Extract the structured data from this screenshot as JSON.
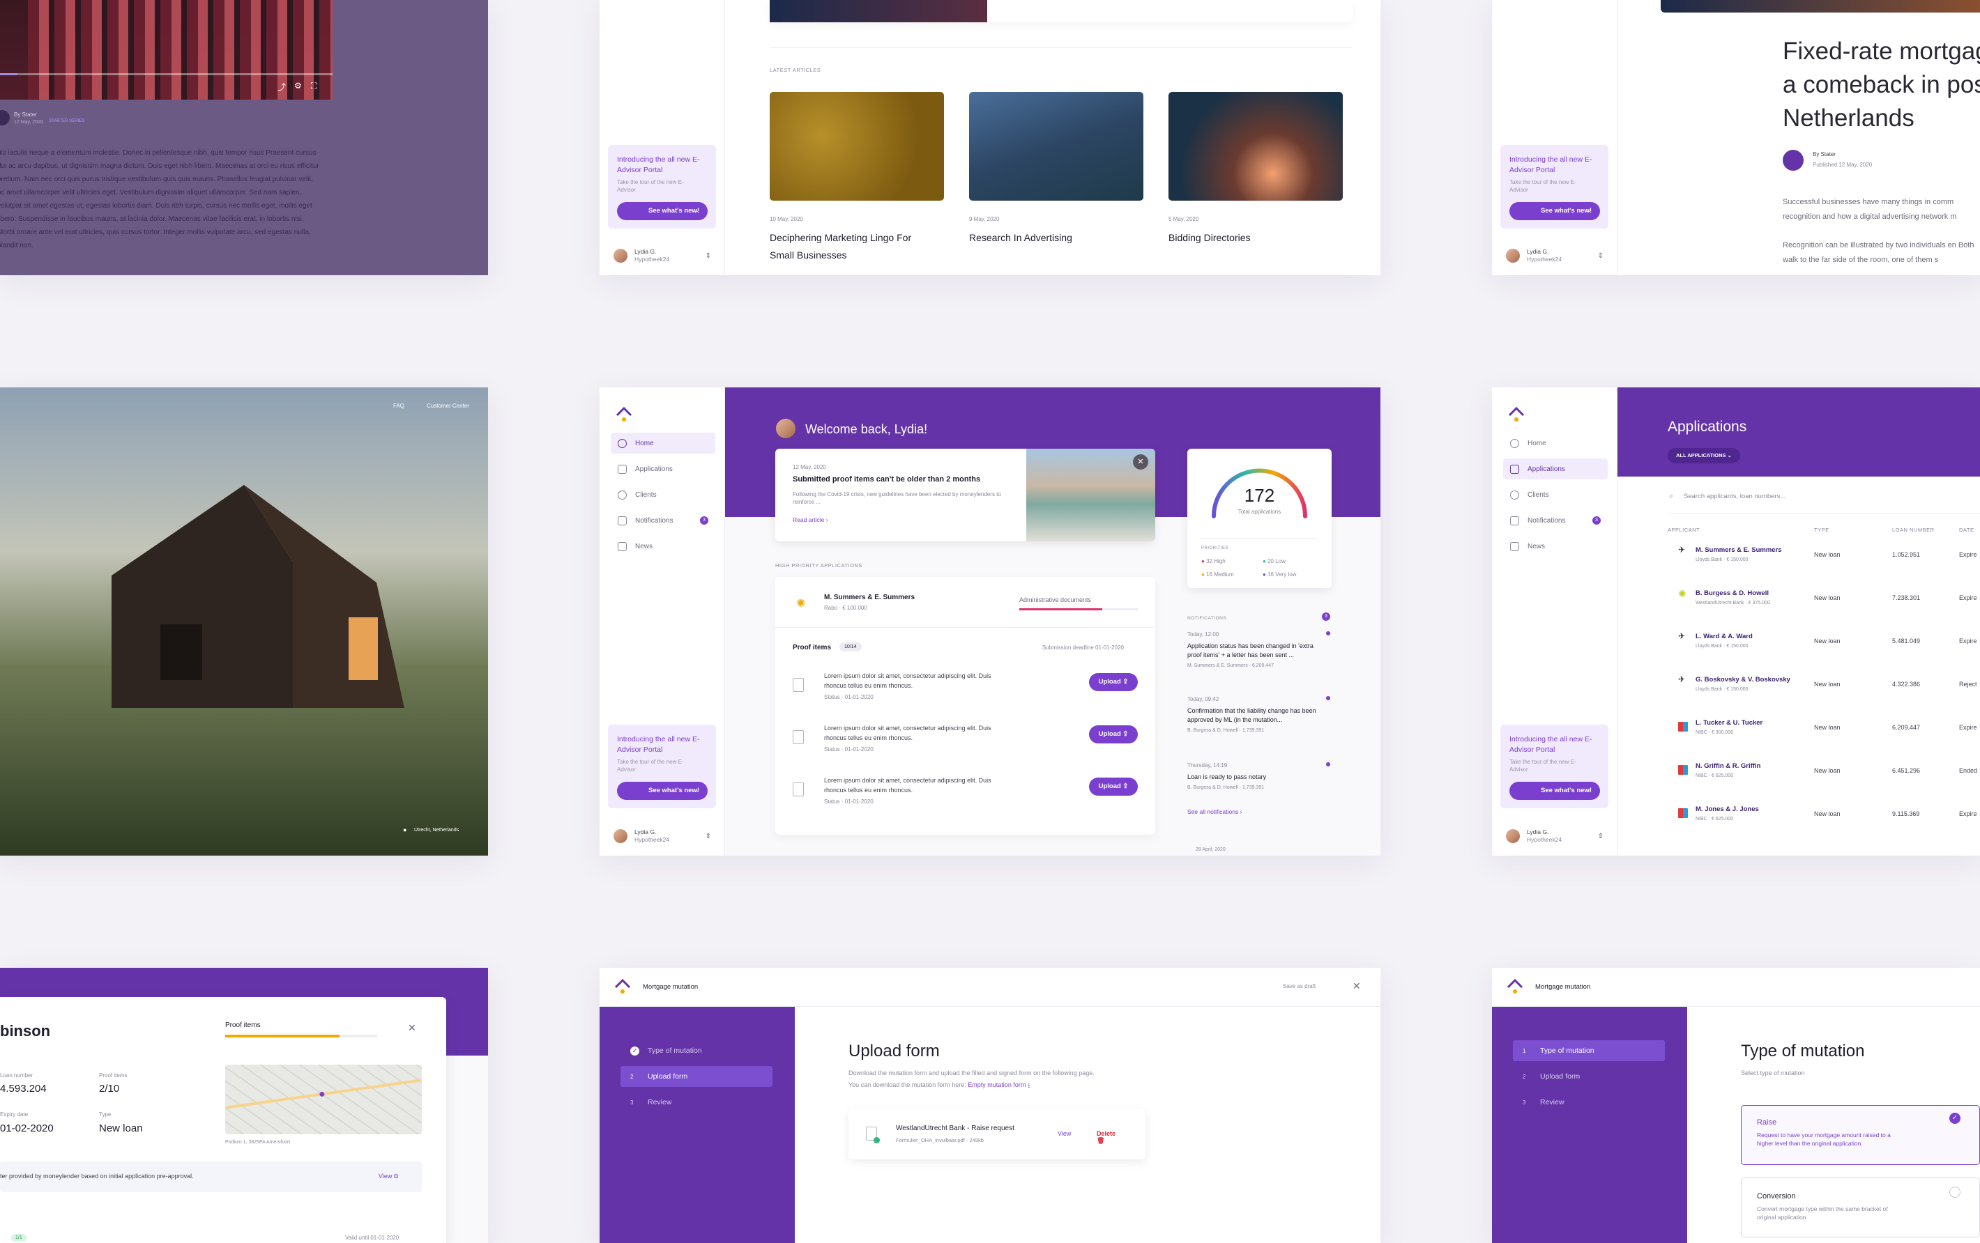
{
  "video_card": {
    "byline": "By Stater",
    "date": "12 May, 2020",
    "tag": "STARTER SERIES",
    "body": "uis iaculis neque a elementum molestie. Donec in pellentesque nibh, quis tempor risus Praesent cursus dui ac arcu dapibus, ut dignissim magna dictum. Duis eget nibh libero. Maecenas at orci eu risus efficitur pretium. Nam nec orci quis purus tristique vestibulum quis quis mauris. Phasellus feugiat pulvinar velit, ac amet ullamcorper velit ultricies eget. Vestibulum dignissim aliquet ullamcorper. Sed nam sapien, volutpat sit amet egestas ut, egestas lobortis diam. Duis ribh turpis, cursus nec mollis eget, mollis eget libero. Suspendisse in faucibus mauris, at lacinia dolor. Maecenas vitae facilisis erat, in lobortis nisi. Morbi ornare ante vel erat ultricies, quis cursus tortor. Integer mollis vulputate arcu, sed egestas nulla, blandit non."
  },
  "promo": {
    "title": "Introducing the all new E-Advisor Portal",
    "subtitle": "Take the tour of the new E-Advisor",
    "button": "See what's new!"
  },
  "user": {
    "name": "Lydia G.",
    "company": "Hypotheek24"
  },
  "articles": {
    "section": "LATEST ARTICLES",
    "items": [
      {
        "date": "10 May, 2020",
        "title": "Deciphering Marketing Lingo For Small Businesses"
      },
      {
        "date": "9 May, 2020",
        "title": "Research In Advertising"
      },
      {
        "date": "5 May, 2020",
        "title": "Bidding Directories"
      }
    ]
  },
  "article_detail": {
    "title": "Fixed-rate mortgag a comeback in pos Netherlands",
    "byline": "By Stater",
    "published": "Published 12 May, 2020",
    "p1": "Successful businesses have many things in comm recognition and how a digital advertising network m",
    "p2": "Recognition can be illustrated by two individuals en Both walk to the far side of the room, one of them s"
  },
  "photo_card": {
    "links": [
      "FAQ",
      "Customer Center"
    ],
    "location": "Utrecht, Netherlands"
  },
  "nav": {
    "items": [
      "Home",
      "Applications",
      "Clients",
      "Notifications",
      "News"
    ],
    "badge": "3"
  },
  "dashboard": {
    "welcome": "Welcome back, Lydia!",
    "news_date": "12 May, 2020",
    "news_title": "Submitted proof items can't be older than 2 months",
    "news_body": "Following the Covid-19 crisis, new guidelines have been elected by moneylenders to reinforce ...",
    "read_article": "Read article",
    "hp_section": "HIGH PRIORITY APPLICATIONS",
    "applicant": "M. Summers & E. Summers",
    "applicant_meta": "Rabo · € 100.000",
    "progress_label": "Administrative documents",
    "proof_items": "Proof items",
    "proof_count": "10/14",
    "deadline": "Submission deadline 01-01-2020",
    "lorem": "Lorem ipsum dolor sit amet, consectetur adipiscing elit. Duis rhoncus tellus eu enim rhoncus.",
    "status": "Status · 01-01-2020",
    "upload": "Upload",
    "total": "172",
    "total_label": "Total applications",
    "priorities_label": "PRIORITIES",
    "priorities": [
      "32 High",
      "20 Low",
      "16 Medium",
      "16 Very low"
    ],
    "notif_label": "NOTIFICATIONS",
    "notif_badge": "3",
    "notifications": [
      {
        "time": "Today, 12:00",
        "text": "Application status has been changed in 'extra proof items' + a letter has been sent ...",
        "meta": "M. Summers & E. Summers · 6.209.447"
      },
      {
        "time": "Today, 09:42",
        "text": "Confirmation that the liability change has been approved by ML (in the mutation...",
        "meta": "B. Burgess & D. Howell · 1.739.391"
      },
      {
        "time": "Thursday, 14:19",
        "text": "Loan is ready to pass notary",
        "meta": "B. Burgess & D. Howell · 1.739.391"
      }
    ],
    "see_all": "See all notifications",
    "footer_date": "28 April, 2020"
  },
  "applications": {
    "title": "Applications",
    "filter": "ALL APPLICATIONS",
    "search_placeholder": "Search applicants, loan numbers...",
    "headers": [
      "APPLICANT",
      "TYPE",
      "LOAN NUMBER",
      "DATE"
    ],
    "rows": [
      {
        "name": "M. Summers & E. Summers",
        "meta": "Lloyds Bank · € 150.000",
        "type": "New loan",
        "loan": "1.052.951",
        "date": "Expire"
      },
      {
        "name": "B. Burgess & D. Howell",
        "meta": "WestlandUtrecht Bank · € 375.000",
        "type": "New loan",
        "loan": "7.238.301",
        "date": "Expire"
      },
      {
        "name": "L. Ward & A. Ward",
        "meta": "Lloyds Bank · € 150.000",
        "type": "New loan",
        "loan": "5.481.049",
        "date": "Expire"
      },
      {
        "name": "G. Boskovsky & V. Boskovsky",
        "meta": "Lloyds Bank · € 150.000",
        "type": "New loan",
        "loan": "4.322.386",
        "date": "Reject"
      },
      {
        "name": "L. Tucker & U. Tucker",
        "meta": "NIBC · € 300.000",
        "type": "New loan",
        "loan": "6.209.447",
        "date": "Expire"
      },
      {
        "name": "N. Griffin & R. Griffin",
        "meta": "NIBC · € 625.000",
        "type": "New loan",
        "loan": "6.451.296",
        "date": "Ended"
      },
      {
        "name": "M. Jones & J. Jones",
        "meta": "NIBC · € 625.000",
        "type": "New loan",
        "loan": "9.115.369",
        "date": "Expire"
      }
    ]
  },
  "loan_detail": {
    "name": "binson",
    "proof_label": "Proof items",
    "loan_number_label": "Loan number",
    "loan_number": "4.593.204",
    "proof_items_label": "Proof items",
    "proof_items": "2/10",
    "expiry_label": "Expiry date",
    "expiry": "01-02-2020",
    "type_label": "Type",
    "type": "New loan",
    "address": "Podium 1, 3825PA Amersfoort",
    "offer_text": "ter provided by moneylender based on initial application pre-approval.",
    "view": "View",
    "pill": "1/1",
    "valid": "Valid until 01-01-2020"
  },
  "upload_form": {
    "header": "Mortgage mutation",
    "save_draft": "Save as draft",
    "steps": [
      "Type of mutation",
      "Upload form",
      "Review"
    ],
    "title": "Upload form",
    "desc1": "Download the mutation form and upload the filled and signed form on the following page.",
    "desc2": "You can download the mutation form here:",
    "link": "Empty mutation form",
    "file_title": "WestlandUtrecht Bank - Raise request",
    "file_meta": "Formulier_OHA_invulbaar.pdf · 249kb",
    "view": "View",
    "delete": "Delete"
  },
  "type_form": {
    "header": "Mortgage mutation",
    "steps": [
      "Type of mutation",
      "Upload form",
      "Review"
    ],
    "title": "Type of mutation",
    "subtitle": "Select type of mutation",
    "options": [
      {
        "title": "Raise",
        "desc": "Request to have your mortgage amount raised to a higher level than the original application"
      },
      {
        "title": "Conversion",
        "desc": "Convert mortgage type within the same bracket of original application"
      }
    ]
  }
}
